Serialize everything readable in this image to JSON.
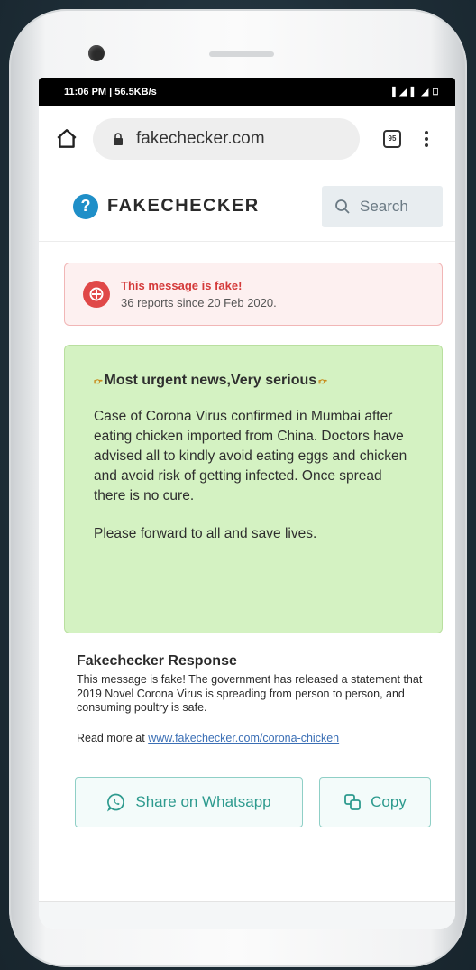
{
  "status_bar": {
    "left": "11:06 PM | 56.5KB/s",
    "right": "▌◢ ▌ ◢ ⎕"
  },
  "browser": {
    "url": "fakechecker.com",
    "tab_count": "95"
  },
  "site": {
    "brand_mark": "?",
    "brand_name": "FAKECHECKER",
    "search_label": "Search"
  },
  "alert": {
    "title": "This message is fake!",
    "subtitle": "36 reports since 20 Feb 2020."
  },
  "message": {
    "headline": "Most urgent news,Very serious",
    "body": "Case of Corona Virus confirmed in Mumbai after eating chicken imported from China. Doctors have advised all to kindly avoid eating eggs and chicken and avoid risk of getting infected. Once spread there is no cure.",
    "forward": "Please forward to all and save lives."
  },
  "response": {
    "title": "Fakechecker Response",
    "text": "This message is fake! The government has released a statement that 2019 Novel Corona Virus is spreading from person to person, and consuming poultry is safe.",
    "read_more_prefix": "Read more at",
    "read_more_link": "www.fakechecker.com/corona-chicken"
  },
  "actions": {
    "share_label": "Share on Whatsapp",
    "copy_label": "Copy"
  },
  "colors": {
    "brand": "#1f8fc8",
    "alert_red": "#d43a3a",
    "message_bg": "#d4f2c2",
    "button_teal": "#2d9a8e"
  }
}
